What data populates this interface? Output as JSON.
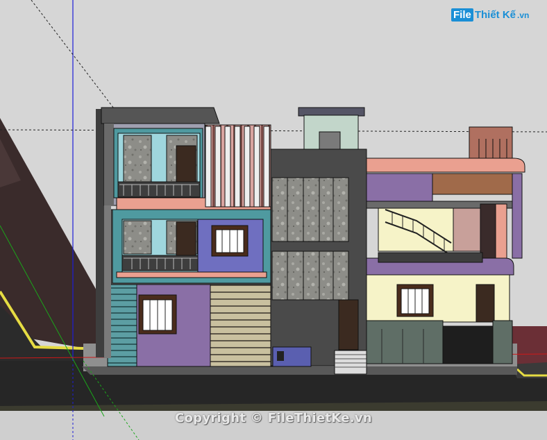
{
  "watermark": {
    "logo_box": "File",
    "logo_text": "Thiết Kế",
    "logo_suffix": ".vn",
    "copyright": "Copyright © FileThietKe.vn"
  },
  "viewport": {
    "background": "#d6d6d6",
    "blue_axis_color": "#1c1cd8",
    "green_axis_color": "#1aa61a",
    "red_axis_color": "#d01818"
  },
  "colors": {
    "purple": "#8a6fa6",
    "violet_panel": "#6f6fc0",
    "teal": "#4f9aa0",
    "salmon": "#eaa090",
    "cream": "#f6f3c8",
    "dark_gray": "#4a4a4a",
    "stone": "#9a9a94",
    "beige_stripes": "#c8bfa0",
    "olive_base": "#5f6e66"
  }
}
